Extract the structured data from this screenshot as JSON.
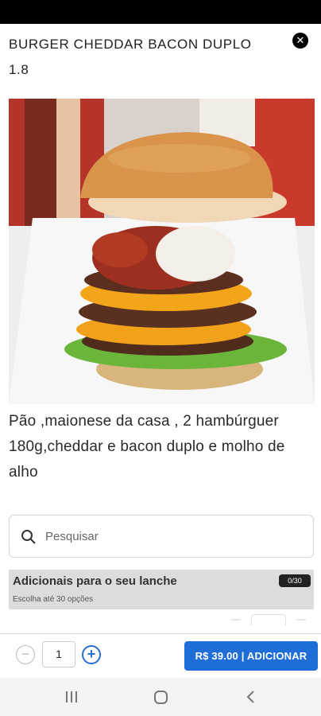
{
  "product": {
    "title": "BURGER CHEDDAR BACON DUPLO",
    "subtitle": "1.8",
    "description": "Pão ,maionese da casa , 2 hambúrguer 180g,cheddar e bacon duplo e molho de alho"
  },
  "search": {
    "placeholder": "Pesquisar",
    "value": ""
  },
  "addons": {
    "title": "Adicionais para o seu lanche",
    "subtitle": "Escolha até 30 opções",
    "counter": "0/30"
  },
  "footer": {
    "quantity": "1",
    "add_button": "R$ 39.00 | ADICIONAR"
  },
  "colors": {
    "accent": "#1f6ed8",
    "section_bg": "#dcdcdc"
  },
  "icons": {
    "close": "close-icon",
    "search": "search-icon",
    "minus": "minus-circle-icon",
    "plus": "plus-circle-icon"
  }
}
